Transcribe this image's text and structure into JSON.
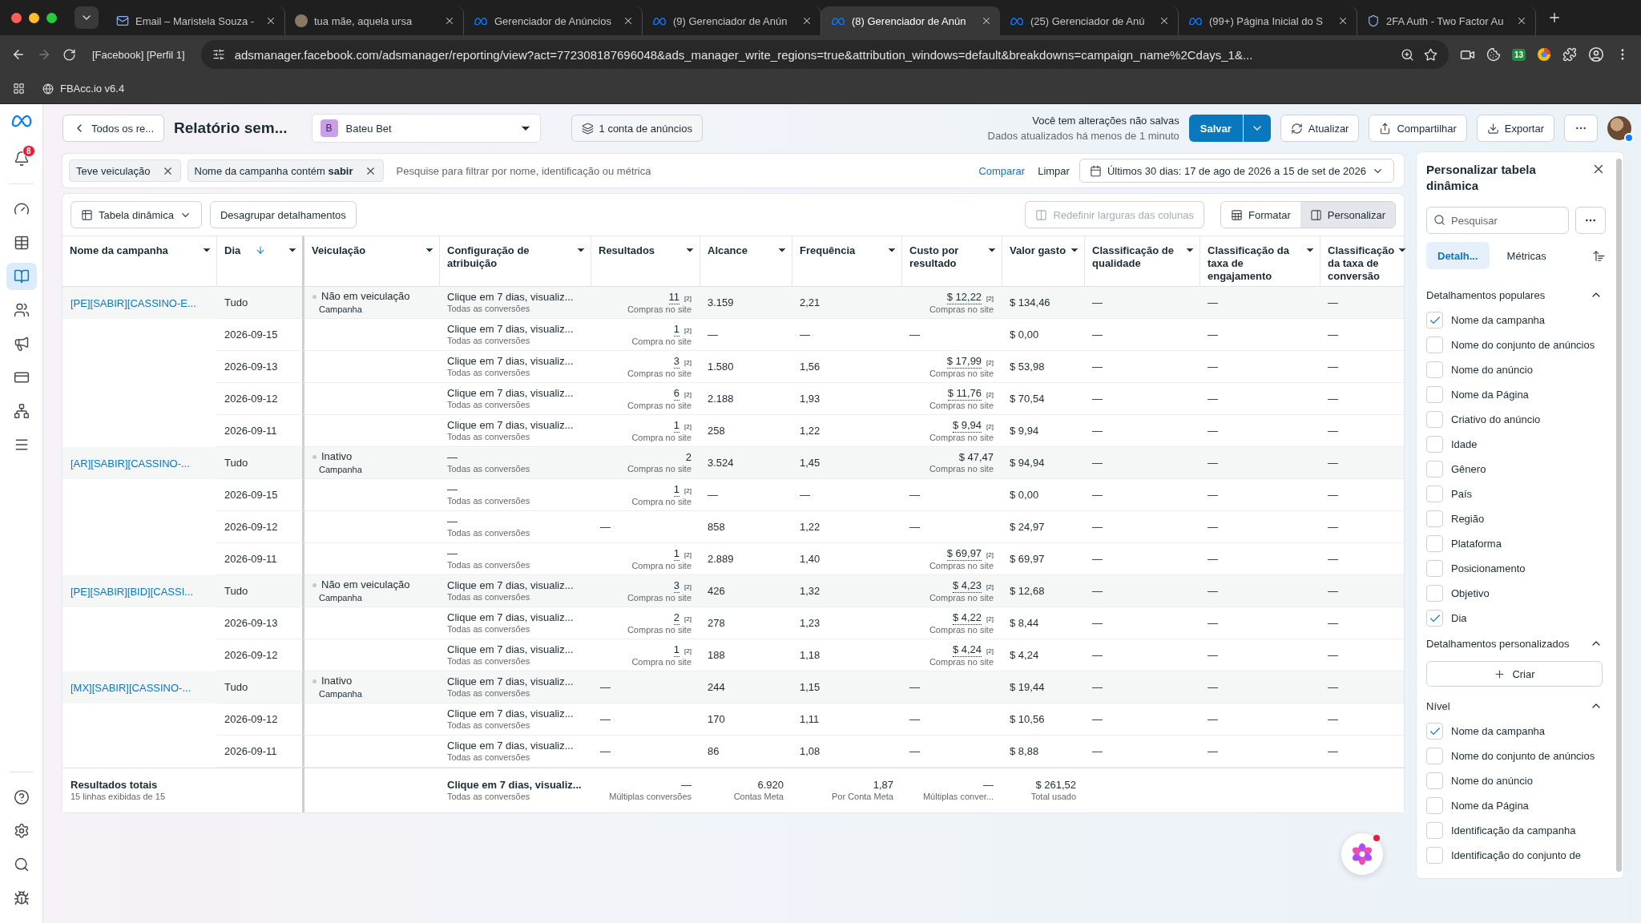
{
  "browser": {
    "tabs": [
      {
        "title": "Email – Maristela Souza -",
        "kind": "mail",
        "selected": false
      },
      {
        "title": "tua mãe, aquela ursa",
        "kind": "avatar",
        "selected": false
      },
      {
        "title": "Gerenciador de Anúncios",
        "kind": "meta",
        "selected": false
      },
      {
        "title": "(9) Gerenciador de Anún",
        "kind": "meta",
        "selected": false
      },
      {
        "title": "(8) Gerenciador de Anún",
        "kind": "meta",
        "selected": true
      },
      {
        "title": "(25) Gerenciador de Anú",
        "kind": "meta",
        "selected": false
      },
      {
        "title": "(99+) Página Inicial do S",
        "kind": "meta",
        "selected": false
      },
      {
        "title": "2FA Auth - Two Factor Au",
        "kind": "shield",
        "selected": false
      }
    ],
    "profile_label": "[Facebook] [Perfil 1]",
    "url": "adsmanager.facebook.com/adsmanager/reporting/view?act=772308187696048&ads_manager_write_regions=true&attribution_windows=default&breakdowns=campaign_name%2Cdays_1&...",
    "extension_badge": "13",
    "bookmarks": [
      "FBAcc.io v6.4"
    ]
  },
  "nav": {
    "notifications": "8",
    "items": [
      {
        "kind": "dashboard",
        "selected": false
      },
      {
        "kind": "table",
        "selected": false
      },
      {
        "kind": "reports",
        "selected": true
      },
      {
        "kind": "audiences",
        "selected": false
      },
      {
        "kind": "ads",
        "selected": false
      },
      {
        "kind": "billing",
        "selected": false
      },
      {
        "kind": "events",
        "selected": false
      },
      {
        "kind": "menu",
        "selected": false
      }
    ],
    "bottom": [
      {
        "kind": "help"
      },
      {
        "kind": "settings"
      },
      {
        "kind": "search"
      },
      {
        "kind": "bug"
      }
    ]
  },
  "header": {
    "back_label": "Todos os re...",
    "report_title": "Relatório sem...",
    "account": {
      "initial": "B",
      "name": "Bateu Bet"
    },
    "accounts_button": "1 conta de anúncios",
    "unsaved_notice": "Você tem alterações não salvas",
    "updated_notice": "Dados atualizados há menos de 1 minuto",
    "save_button": "Salvar",
    "actions": [
      {
        "label": "Atualizar",
        "kind": "refresh"
      },
      {
        "label": "Compartilhar",
        "kind": "share"
      },
      {
        "label": "Exportar",
        "kind": "export"
      }
    ]
  },
  "filters": {
    "chips": [
      "Teve veiculação",
      "Nome da campanha contém **sabir**"
    ],
    "search_placeholder": "Pesquise para filtrar por nome, identificação ou métrica",
    "compare": "Comparar",
    "clear": "Limpar",
    "date_range": "Últimos 30 dias: 17 de ago de 2026 a 15 de set de 2026"
  },
  "toolbar": {
    "pivot": "Tabela dinâmica",
    "ungroup": "Desagrupar detalhamentos",
    "reset_widths": {
      "label": "Redefinir larguras das colunas",
      "disabled": true
    },
    "view_buttons": [
      {
        "label": "Formatar",
        "kind": "format",
        "selected": false
      },
      {
        "label": "Personalizar",
        "kind": "customize",
        "selected": true
      }
    ]
  },
  "table": {
    "columns": [
      {
        "label": "Nome da campanha",
        "sorted": false
      },
      {
        "label": "Dia",
        "sorted": true
      },
      {
        "label": "Veiculação",
        "sorted": false
      },
      {
        "label": "Configuração de atribuição",
        "sorted": false
      },
      {
        "label": "Resultados",
        "sorted": false
      },
      {
        "label": "Alcance",
        "sorted": false
      },
      {
        "label": "Frequência",
        "sorted": false
      },
      {
        "label": "Custo por resultado",
        "sorted": false
      },
      {
        "label": "Valor gasto",
        "sorted": false
      },
      {
        "label": "Classificação de qualidade",
        "sorted": false
      },
      {
        "label": "Classificação da taxa de engajamento",
        "sorted": false
      },
      {
        "label": "Classificação da taxa de conversão",
        "sorted": false
      }
    ],
    "rows": [
      {
        "kind": "campaign",
        "campaign": "[PE][SABIR][CASSINO-E...",
        "day": "Tudo",
        "delivery": {
          "status": "Não em veiculação",
          "sub": "Campanha"
        },
        "attribution": {
          "main": "Clique em 7 dias, visualiz...",
          "sub": "Todas as conversões"
        },
        "results": {
          "value": "11",
          "note": "[2]",
          "sub": "Compras no site"
        },
        "reach": "3.159",
        "frequency": "2,21",
        "cost": {
          "value": "$ 12,22",
          "note": "[2]",
          "sub": "Compras no site"
        },
        "spent": "$ 134,46",
        "ratings": [
          "—",
          "—",
          "—"
        ]
      },
      {
        "kind": "day",
        "day": "2026-09-15",
        "attribution": {
          "main": "Clique em 7 dias, visualiz...",
          "sub": "Todas as conversões"
        },
        "results": {
          "value": "1",
          "note": "[2]",
          "sub": "Compra no site"
        },
        "reach": "—",
        "frequency": "—",
        "cost": {
          "value": "—"
        },
        "spent": "$ 0,00",
        "ratings": [
          "—",
          "—",
          "—"
        ]
      },
      {
        "kind": "day",
        "day": "2026-09-13",
        "attribution": {
          "main": "Clique em 7 dias, visualiz...",
          "sub": "Todas as conversões"
        },
        "results": {
          "value": "3",
          "note": "[2]",
          "sub": "Compras no site"
        },
        "reach": "1.580",
        "frequency": "1,56",
        "cost": {
          "value": "$ 17,99",
          "note": "[2]",
          "sub": "Compras no site"
        },
        "spent": "$ 53,98",
        "ratings": [
          "—",
          "—",
          "—"
        ]
      },
      {
        "kind": "day",
        "day": "2026-09-12",
        "attribution": {
          "main": "Clique em 7 dias, visualiz...",
          "sub": "Todas as conversões"
        },
        "results": {
          "value": "6",
          "note": "[2]",
          "sub": "Compras no site"
        },
        "reach": "2.188",
        "frequency": "1,93",
        "cost": {
          "value": "$ 11,76",
          "note": "[2]",
          "sub": "Compras no site"
        },
        "spent": "$ 70,54",
        "ratings": [
          "—",
          "—",
          "—"
        ]
      },
      {
        "kind": "day",
        "day": "2026-09-11",
        "attribution": {
          "main": "Clique em 7 dias, visualiz...",
          "sub": "Todas as conversões"
        },
        "results": {
          "value": "1",
          "note": "[2]",
          "sub": "Compra no site"
        },
        "reach": "258",
        "frequency": "1,22",
        "cost": {
          "value": "$ 9,94",
          "note": "[2]",
          "sub": "Compras no site"
        },
        "spent": "$ 9,94",
        "ratings": [
          "—",
          "—",
          "—"
        ]
      },
      {
        "kind": "campaign",
        "campaign": "[AR][SABIR][CASSINO-...",
        "day": "Tudo",
        "delivery": {
          "status": "Inativo",
          "sub": "Campanha"
        },
        "attribution": {
          "main": "—",
          "sub": "Todas as conversões"
        },
        "results": {
          "value": "2",
          "sub": "Compras no site"
        },
        "reach": "3.524",
        "frequency": "1,45",
        "cost": {
          "value": "$ 47,47",
          "sub": "Compras no site"
        },
        "spent": "$ 94,94",
        "ratings": [
          "—",
          "—",
          "—"
        ]
      },
      {
        "kind": "day",
        "day": "2026-09-15",
        "attribution": {
          "main": "—",
          "sub": "Todas as conversões"
        },
        "results": {
          "value": "1",
          "note": "[2]",
          "sub": "Compra no site"
        },
        "reach": "—",
        "frequency": "—",
        "cost": {
          "value": "—"
        },
        "spent": "$ 0,00",
        "ratings": [
          "—",
          "—",
          "—"
        ]
      },
      {
        "kind": "day",
        "day": "2026-09-12",
        "attribution": {
          "main": "—",
          "sub": "Todas as conversões"
        },
        "results": {
          "value": "—"
        },
        "reach": "858",
        "frequency": "1,22",
        "cost": {
          "value": "—"
        },
        "spent": "$ 24,97",
        "ratings": [
          "—",
          "—",
          "—"
        ]
      },
      {
        "kind": "day",
        "day": "2026-09-11",
        "attribution": {
          "main": "—",
          "sub": "Todas as conversões"
        },
        "results": {
          "value": "1",
          "note": "[2]",
          "sub": "Compra no site"
        },
        "reach": "2.889",
        "frequency": "1,40",
        "cost": {
          "value": "$ 69,97",
          "note": "[2]",
          "sub": "Compras no site"
        },
        "spent": "$ 69,97",
        "ratings": [
          "—",
          "—",
          "—"
        ]
      },
      {
        "kind": "campaign",
        "campaign": "[PE][SABIR][BID][CASSI...",
        "day": "Tudo",
        "delivery": {
          "status": "Não em veiculação",
          "sub": "Campanha"
        },
        "attribution": {
          "main": "Clique em 7 dias, visualiz...",
          "sub": "Todas as conversões"
        },
        "results": {
          "value": "3",
          "note": "[2]",
          "sub": "Compras no site"
        },
        "reach": "426",
        "frequency": "1,32",
        "cost": {
          "value": "$ 4,23",
          "note": "[2]",
          "sub": "Compras no site"
        },
        "spent": "$ 12,68",
        "ratings": [
          "—",
          "—",
          "—"
        ]
      },
      {
        "kind": "day",
        "day": "2026-09-13",
        "attribution": {
          "main": "Clique em 7 dias, visualiz...",
          "sub": "Todas as conversões"
        },
        "results": {
          "value": "2",
          "note": "[2]",
          "sub": "Compras no site"
        },
        "reach": "278",
        "frequency": "1,23",
        "cost": {
          "value": "$ 4,22",
          "note": "[2]",
          "sub": "Compras no site"
        },
        "spent": "$ 8,44",
        "ratings": [
          "—",
          "—",
          "—"
        ]
      },
      {
        "kind": "day",
        "day": "2026-09-12",
        "attribution": {
          "main": "Clique em 7 dias, visualiz...",
          "sub": "Todas as conversões"
        },
        "results": {
          "value": "1",
          "note": "[2]",
          "sub": "Compra no site"
        },
        "reach": "188",
        "frequency": "1,18",
        "cost": {
          "value": "$ 4,24",
          "note": "[2]",
          "sub": "Compras no site"
        },
        "spent": "$ 4,24",
        "ratings": [
          "—",
          "—",
          "—"
        ]
      },
      {
        "kind": "campaign",
        "campaign": "[MX][SABIR][CASSINO-...",
        "day": "Tudo",
        "delivery": {
          "status": "Inativo",
          "sub": "Campanha"
        },
        "attribution": {
          "main": "Clique em 7 dias, visualiz...",
          "sub": "Todas as conversões"
        },
        "results": {
          "value": "—"
        },
        "reach": "244",
        "frequency": "1,15",
        "cost": {
          "value": "—"
        },
        "spent": "$ 19,44",
        "ratings": [
          "—",
          "—",
          "—"
        ]
      },
      {
        "kind": "day",
        "day": "2026-09-12",
        "attribution": {
          "main": "Clique em 7 dias, visualiz...",
          "sub": "Todas as conversões"
        },
        "results": {
          "value": "—"
        },
        "reach": "170",
        "frequency": "1,11",
        "cost": {
          "value": "—"
        },
        "spent": "$ 10,56",
        "ratings": [
          "—",
          "—",
          "—"
        ]
      },
      {
        "kind": "day",
        "day": "2026-09-11",
        "attribution": {
          "main": "Clique em 7 dias, visualiz...",
          "sub": "Todas as conversões"
        },
        "results": {
          "value": "—"
        },
        "reach": "86",
        "frequency": "1,08",
        "cost": {
          "value": "—"
        },
        "spent": "$ 8,88",
        "ratings": [
          "—",
          "—",
          "—"
        ]
      }
    ],
    "totals": {
      "label": "Resultados totais",
      "sub": "15 linhas exibidas de 15",
      "attribution": {
        "main": "Clique em 7 dias, visualiz...",
        "sub": "Todas as conversões"
      },
      "results": {
        "value": "—",
        "sub": "Múltiplas conversões"
      },
      "reach": {
        "value": "6.920",
        "sub": "Contas Meta"
      },
      "frequency": {
        "value": "1,87",
        "sub": "Por Conta Meta"
      },
      "cost": {
        "value": "—",
        "sub": "Múltiplas conver..."
      },
      "spent": {
        "value": "$ 261,52",
        "sub": "Total usado"
      }
    }
  },
  "breakdown_panel": {
    "title": "Personalizar tabela dinâmica",
    "search_placeholder": "Pesquisar",
    "tabs": [
      {
        "label": "Detalh...",
        "selected": true
      },
      {
        "label": "Métricas",
        "selected": false
      }
    ],
    "sections": [
      {
        "title": "Detalhamentos populares",
        "expanded": true,
        "items": [
          {
            "label": "Nome da campanha",
            "checked": true
          },
          {
            "label": "Nome do conjunto de anúncios",
            "checked": false
          },
          {
            "label": "Nome do anúncio",
            "checked": false
          },
          {
            "label": "Nome da Página",
            "checked": false
          },
          {
            "label": "Criativo do anúncio",
            "checked": false
          },
          {
            "label": "Idade",
            "checked": false
          },
          {
            "label": "Gênero",
            "checked": false
          },
          {
            "label": "País",
            "checked": false
          },
          {
            "label": "Região",
            "checked": false
          },
          {
            "label": "Plataforma",
            "checked": false
          },
          {
            "label": "Posicionamento",
            "checked": false
          },
          {
            "label": "Objetivo",
            "checked": false
          },
          {
            "label": "Dia",
            "checked": true
          }
        ]
      },
      {
        "title": "Detalhamentos personalizados",
        "expanded": true,
        "create_button": "Criar"
      },
      {
        "title": "Nível",
        "expanded": true,
        "items": [
          {
            "label": "Nome da campanha",
            "checked": true
          },
          {
            "label": "Nome do conjunto de anúncios",
            "checked": false
          },
          {
            "label": "Nome do anúncio",
            "checked": false
          },
          {
            "label": "Nome da Página",
            "checked": false
          },
          {
            "label": "Identificação da campanha",
            "checked": false
          },
          {
            "label": "Identificação do conjunto de",
            "checked": false
          }
        ]
      }
    ]
  }
}
